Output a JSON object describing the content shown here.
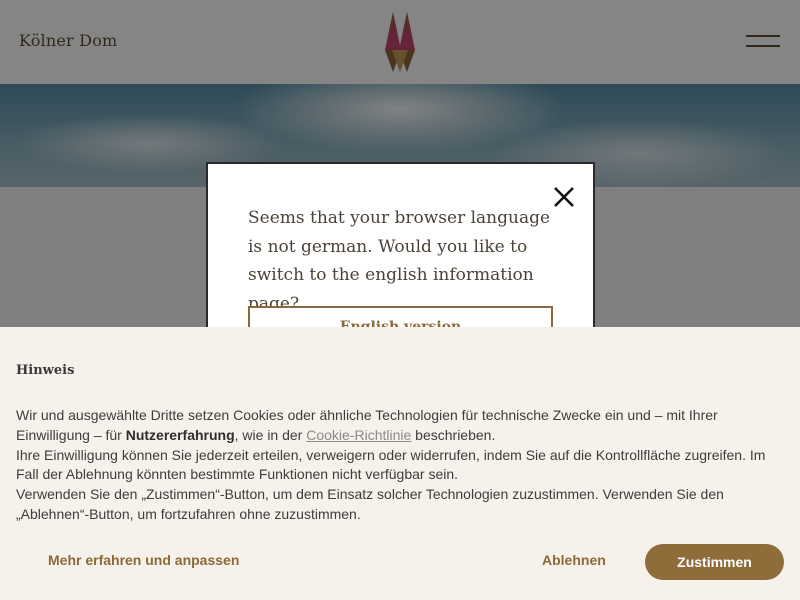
{
  "header": {
    "brand": "Kölner Dom",
    "logo_icon": "cathedral-logo-icon",
    "menu_icon": "hamburger-menu-icon"
  },
  "language_dialog": {
    "message": "Seems that your browser language is not german. Would you like to switch to the english information page?",
    "button_label": "English version",
    "close_icon": "close-icon"
  },
  "cookie_banner": {
    "title": "Hinweis",
    "p1_a": "Wir und ausgewählte Dritte setzen Cookies oder ähnliche Technologien für technische Zwecke ein und – mit Ihrer Einwilligung – für ",
    "p1_bold": "Nutzererfahrung",
    "p1_b": ", wie in der ",
    "p1_link": "Cookie-Richtlinie",
    "p1_c": " beschrieben.",
    "p2": "Ihre Einwilligung können Sie jederzeit erteilen, verweigern oder widerrufen, indem Sie auf die Kontrollfläche zugreifen. Im Fall der Ablehnung könnten bestimmte Funktionen nicht verfügbar sein.",
    "p3": "Verwenden Sie den „Zustimmen“-Button, um dem Einsatz solcher Technologien zuzustimmen. Verwenden Sie den „Ablehnen“-Button, um fortzufahren ohne zuzustimmen.",
    "more_label": "Mehr erfahren und anpassen",
    "reject_label": "Ablehnen",
    "accept_label": "Zustimmen"
  },
  "colors": {
    "brand_brown": "#8e6d3b",
    "text_dark": "#3d3d3d",
    "banner_bg": "#f6f1ea"
  }
}
